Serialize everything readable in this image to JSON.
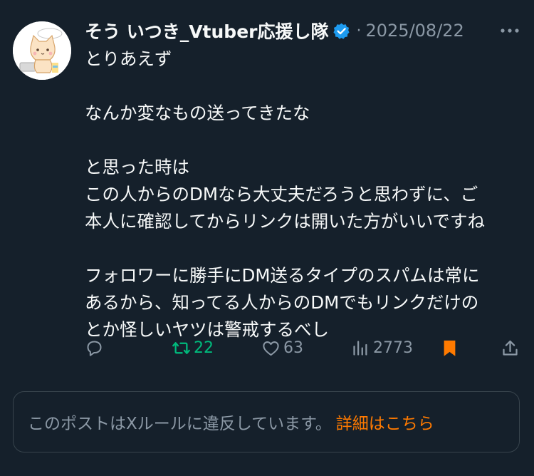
{
  "post": {
    "author_name": "そう いつき_Vtuber応援し隊",
    "separator": "·",
    "date": "2025/08/22",
    "lines": [
      "とりあえず",
      "",
      "なんか変なもの送ってきたな",
      "",
      "と思った時は",
      "この人からのDMなら大丈夫だろうと思わずに、ご",
      "本人に確認してからリンクは開いた方がいいですね",
      "",
      "フォロワーに勝手にDM送るタイプのスパムは常に",
      "あるから、知ってる人からのDMでもリンクだけの",
      "とか怪しいヤツは警戒するべし"
    ]
  },
  "actions": {
    "reply_count": "",
    "retweet_count": "22",
    "like_count": "63",
    "views_count": "2773"
  },
  "notice": {
    "message": "このポストはXルールに違反しています。",
    "link_label": "詳細はこちら"
  },
  "colors": {
    "background": "#15202b",
    "text": "#f7f9f9",
    "muted": "#8b98a5",
    "retweet_green": "#00ba7c",
    "bookmark_orange": "#ff7a00",
    "verified_blue": "#1d9bf0",
    "border": "#38444d"
  },
  "icons": [
    "more-icon",
    "verified-badge-icon",
    "reply-icon",
    "retweet-icon",
    "like-icon",
    "views-icon",
    "bookmark-icon",
    "share-icon"
  ]
}
